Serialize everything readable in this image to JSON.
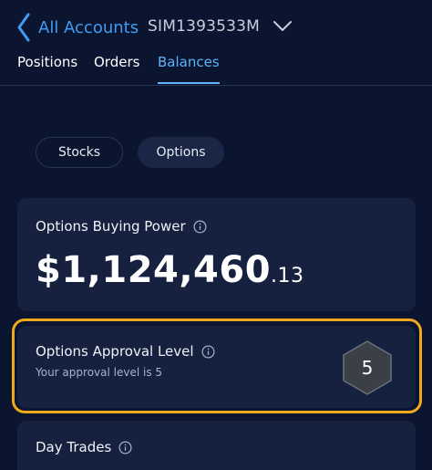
{
  "header": {
    "back_label": "All Accounts",
    "account_id": "SIM1393533M"
  },
  "tabs": [
    {
      "label": "Positions",
      "active": false
    },
    {
      "label": "Orders",
      "active": false
    },
    {
      "label": "Balances",
      "active": true
    }
  ],
  "segments": {
    "stocks_label": "Stocks",
    "options_label": "Options",
    "selected": "Options"
  },
  "buying_power": {
    "title": "Options Buying Power",
    "amount_main": "$1,124,460",
    "amount_cents": ".13"
  },
  "approval": {
    "title": "Options Approval Level",
    "subtitle": "Your approval level is 5",
    "level": "5"
  },
  "day_trades": {
    "title": "Day Trades"
  },
  "colors": {
    "background": "#0b1530",
    "card": "#16213f",
    "accent_blue": "#3f9cf5",
    "highlight": "#f0a81c"
  },
  "icons": [
    "chevron-left-icon",
    "chevron-down-icon",
    "info-icon",
    "hexagon-icon"
  ]
}
